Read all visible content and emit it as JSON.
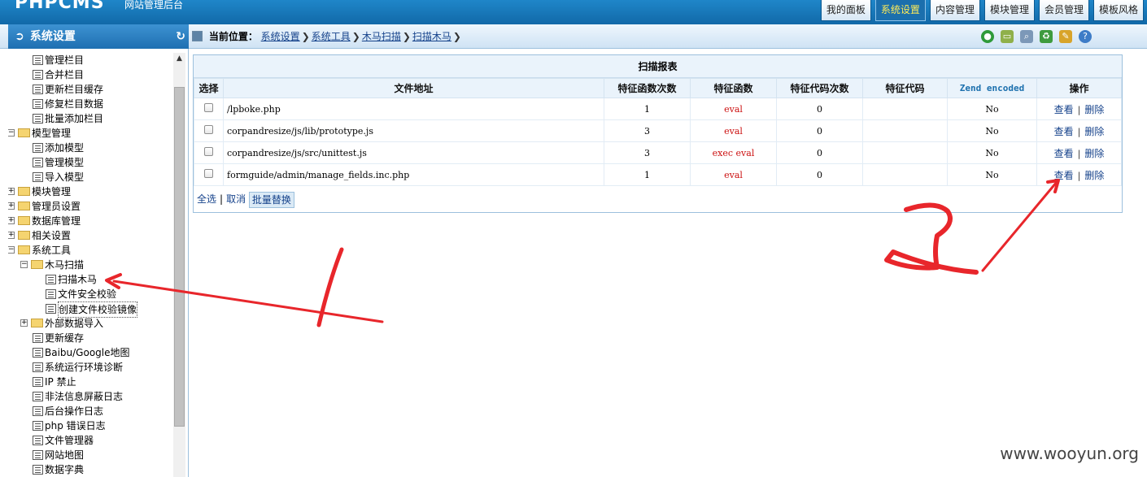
{
  "header": {
    "logo": "PHPCMS",
    "logo_sub": "网站管理后台",
    "tabs": [
      {
        "label": "我的面板",
        "active": false
      },
      {
        "label": "系统设置",
        "active": true
      },
      {
        "label": "内容管理",
        "active": false
      },
      {
        "label": "模块管理",
        "active": false
      },
      {
        "label": "会员管理",
        "active": false
      },
      {
        "label": "模板风格",
        "active": false
      }
    ]
  },
  "sidebar": {
    "title": "系统设置",
    "items": [
      {
        "label": "管理栏目",
        "type": "doc",
        "level": 2
      },
      {
        "label": "合并栏目",
        "type": "doc",
        "level": 2
      },
      {
        "label": "更新栏目缓存",
        "type": "doc",
        "level": 2
      },
      {
        "label": "修复栏目数据",
        "type": "doc",
        "level": 2
      },
      {
        "label": "批量添加栏目",
        "type": "doc",
        "level": 2
      },
      {
        "label": "模型管理",
        "type": "folder-open",
        "level": 1
      },
      {
        "label": "添加模型",
        "type": "doc",
        "level": 2
      },
      {
        "label": "管理模型",
        "type": "doc",
        "level": 2
      },
      {
        "label": "导入模型",
        "type": "doc",
        "level": 2
      },
      {
        "label": "模块管理",
        "type": "folder",
        "level": 1
      },
      {
        "label": "管理员设置",
        "type": "folder",
        "level": 1
      },
      {
        "label": "数据库管理",
        "type": "folder",
        "level": 1
      },
      {
        "label": "相关设置",
        "type": "folder",
        "level": 1
      },
      {
        "label": "系统工具",
        "type": "folder-open",
        "level": 1
      },
      {
        "label": "木马扫描",
        "type": "folder-open",
        "level": 2
      },
      {
        "label": "扫描木马",
        "type": "doc",
        "level": 3
      },
      {
        "label": "文件安全校验",
        "type": "doc",
        "level": 3
      },
      {
        "label": "创建文件校验镜像",
        "type": "doc",
        "level": 3,
        "selected": true
      },
      {
        "label": "外部数据导入",
        "type": "folder",
        "level": 2
      },
      {
        "label": "更新缓存",
        "type": "doc",
        "level": 2
      },
      {
        "label": "Baibu/Google地图",
        "type": "doc",
        "level": 2
      },
      {
        "label": "系统运行环境诊断",
        "type": "doc",
        "level": 2
      },
      {
        "label": "IP 禁止",
        "type": "doc",
        "level": 2
      },
      {
        "label": "非法信息屏蔽日志",
        "type": "doc",
        "level": 2
      },
      {
        "label": "后台操作日志",
        "type": "doc",
        "level": 2
      },
      {
        "label": "php 错误日志",
        "type": "doc",
        "level": 2
      },
      {
        "label": "文件管理器",
        "type": "doc",
        "level": 2
      },
      {
        "label": "网站地图",
        "type": "doc",
        "level": 2
      },
      {
        "label": "数据字典",
        "type": "doc",
        "level": 2
      }
    ]
  },
  "breadcrumb": {
    "prefix": "当前位置：",
    "items": [
      "系统设置",
      "系统工具",
      "木马扫描",
      "扫描木马"
    ]
  },
  "toolbar_icons": [
    "globe-icon",
    "folder-icon",
    "search-icon",
    "recycle-icon",
    "notepad-icon",
    "help-icon"
  ],
  "report": {
    "title": "扫描报表",
    "columns": [
      "选择",
      "文件地址",
      "特征函数次数",
      "特征函数",
      "特征代码次数",
      "特征代码",
      "Zend encoded",
      "操作"
    ],
    "rows": [
      {
        "path": "/lpboke.php",
        "fn_count": "1",
        "fn": "eval",
        "code_count": "0",
        "code": "",
        "zend": "No"
      },
      {
        "path": "corpandresize/js/lib/prototype.js",
        "fn_count": "3",
        "fn": "eval",
        "code_count": "0",
        "code": "",
        "zend": "No"
      },
      {
        "path": "corpandresize/js/src/unittest.js",
        "fn_count": "3",
        "fn": "exec eval",
        "code_count": "0",
        "code": "",
        "zend": "No"
      },
      {
        "path": "formguide/admin/manage_fields.inc.php",
        "fn_count": "1",
        "fn": "eval",
        "code_count": "0",
        "code": "",
        "zend": "No"
      }
    ],
    "view_label": "查看",
    "delete_label": "删除",
    "select_all": "全选",
    "cancel": "取消",
    "batch_replace": "批量替换"
  },
  "watermark": "www.wooyun.org",
  "colors": {
    "header": "#1169a8",
    "annotation": "#e8262b",
    "link": "#15428b",
    "fn_text": "#cc1111"
  }
}
